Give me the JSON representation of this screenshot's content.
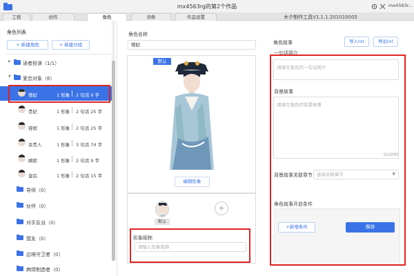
{
  "window": {
    "title": "mx4563rg的第2个作品",
    "version": "木夕制作工具V1.1.1.201010005",
    "user": "mx4563r..."
  },
  "tabs": [
    {
      "label": "工程"
    },
    {
      "label": "创作"
    },
    {
      "label": "角色"
    },
    {
      "label": "词条"
    },
    {
      "label": "作品设置"
    }
  ],
  "sidebar": {
    "title": "角色列表",
    "new_role": "新建角色",
    "new_group": "新建分组",
    "groups_top": [
      {
        "label": "读者扮演（1/1）"
      },
      {
        "label": "爱恋对象（6）"
      }
    ],
    "characters": [
      {
        "name": "德妃",
        "forms": "1 形象",
        "info": "2 句话 9 字"
      },
      {
        "name": "贵妃",
        "forms": "1 形象",
        "info": "2 句话 25 字"
      },
      {
        "name": "容嫔",
        "forms": "1 形象",
        "info": "2 句话 25 字"
      },
      {
        "name": "余贵人",
        "forms": "1 形象",
        "info": "3 句话 74 字"
      },
      {
        "name": "嫡嫔",
        "forms": "1 形象",
        "info": "2 句话 9 字"
      },
      {
        "name": "皇后",
        "forms": "1 形象",
        "info": "2 句话 15 字"
      }
    ],
    "groups_bottom": [
      {
        "label": "导师（0）"
      },
      {
        "label": "伙伴（0）"
      },
      {
        "label": "对手反派（0）"
      },
      {
        "label": "盟友（0）"
      },
      {
        "label": "边境守卫者（0）"
      },
      {
        "label": "麻烦制造者（0）"
      }
    ]
  },
  "center": {
    "name_label": "角色名称",
    "name_value": "德妃",
    "default_badge": "默认",
    "edit_image": "编辑形象",
    "thumb_tag": "默认",
    "add_symbol": "+",
    "form_name_label": "形象昵称",
    "form_name_placeholder": "请输入形象昵称"
  },
  "right": {
    "story_label": "角色故事",
    "import_txt": "导入txt",
    "export_txt": "导出txt",
    "intro_label": "一句话简介",
    "intro_placeholder": "请填写角色的一句话简介",
    "bg_label": "背景故事",
    "bg_placeholder": "请填写角色的背景故事",
    "bg_counter": "0/2000",
    "chapter_label": "背景故事关联章节",
    "chapter_placeholder": "选择关联章节",
    "cond_label": "角色故事开启条件",
    "add_cond": "+新增条件",
    "save": "保存"
  },
  "colors": {
    "accent": "#3b73e6",
    "highlight_box": "#e02323"
  },
  "icons": {
    "logo": "folder-logo-icon",
    "settings": "gear-icon",
    "close": "close-icon"
  }
}
